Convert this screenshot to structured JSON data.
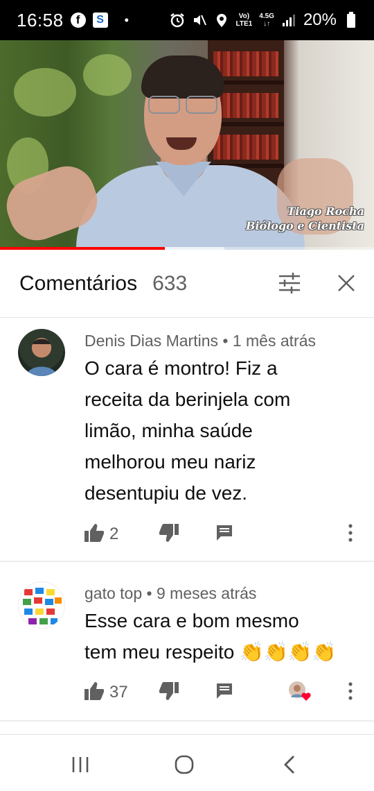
{
  "status_bar": {
    "time": "16:58",
    "fb_glyph": "f",
    "s_glyph": "S",
    "dot": "•",
    "network_top": "Vo)",
    "network_bottom": "LTE1",
    "net_speed_top": "4.5G",
    "net_speed_bottom": "↓↑",
    "battery": "20%",
    "icons": [
      "facebook-icon",
      "app-s-icon",
      "alarm-icon",
      "mute-icon",
      "location-icon",
      "signal-icon",
      "battery-icon"
    ]
  },
  "video": {
    "caption_name": "Tiago Rocha",
    "caption_role": "Biólogo e Cientista",
    "progress_played": 0.44,
    "progress_buffered": 0.6,
    "progress_color": "#ff0000"
  },
  "comments_header": {
    "title": "Comentários",
    "count": "633",
    "icons": [
      "sort-filter-icon",
      "close-icon"
    ]
  },
  "comments": [
    {
      "author": "Denis Dias Martins",
      "time": "• 1 mês atrás",
      "lines": [
        "O cara é montro! Fiz a",
        "receita da berinjela com",
        "limão, minha saúde",
        "melhorou meu nariz",
        "desentupiu de vez."
      ],
      "likes": "2"
    },
    {
      "author": "gato top",
      "time": "• 9 meses atrás",
      "lines": [
        "Esse cara e bom mesmo",
        "tem meu respeito 👏👏👏👏"
      ],
      "likes": "37",
      "creator_heart": true
    }
  ],
  "nav_bar": {
    "icons": [
      "recent-apps-icon",
      "home-icon",
      "back-icon"
    ]
  },
  "colors": {
    "text_primary": "#0f0f0f",
    "text_secondary": "#606060",
    "icon": "#606060",
    "heart": "#ff0033"
  }
}
